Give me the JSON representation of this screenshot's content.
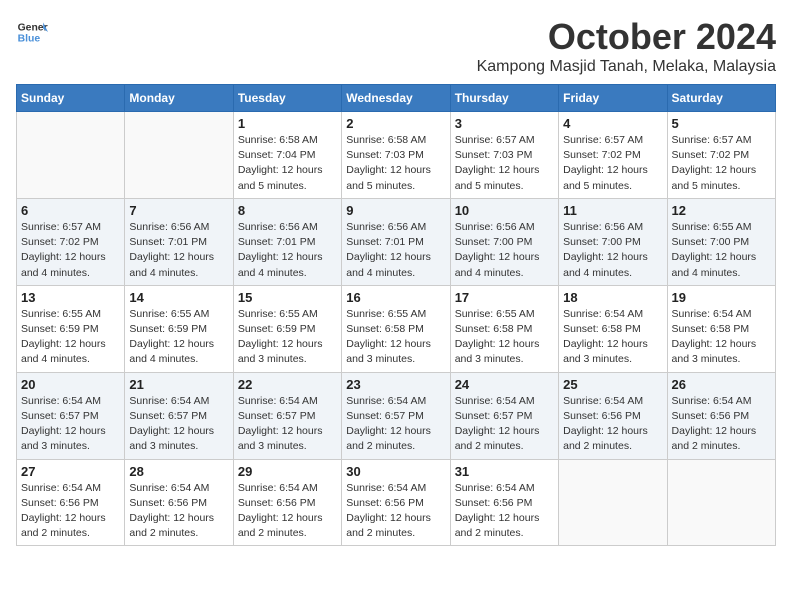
{
  "logo": {
    "line1": "General",
    "line2": "Blue"
  },
  "title": "October 2024",
  "location": "Kampong Masjid Tanah, Melaka, Malaysia",
  "headers": [
    "Sunday",
    "Monday",
    "Tuesday",
    "Wednesday",
    "Thursday",
    "Friday",
    "Saturday"
  ],
  "weeks": [
    [
      {
        "day": "",
        "info": ""
      },
      {
        "day": "",
        "info": ""
      },
      {
        "day": "1",
        "info": "Sunrise: 6:58 AM\nSunset: 7:04 PM\nDaylight: 12 hours\nand 5 minutes."
      },
      {
        "day": "2",
        "info": "Sunrise: 6:58 AM\nSunset: 7:03 PM\nDaylight: 12 hours\nand 5 minutes."
      },
      {
        "day": "3",
        "info": "Sunrise: 6:57 AM\nSunset: 7:03 PM\nDaylight: 12 hours\nand 5 minutes."
      },
      {
        "day": "4",
        "info": "Sunrise: 6:57 AM\nSunset: 7:02 PM\nDaylight: 12 hours\nand 5 minutes."
      },
      {
        "day": "5",
        "info": "Sunrise: 6:57 AM\nSunset: 7:02 PM\nDaylight: 12 hours\nand 5 minutes."
      }
    ],
    [
      {
        "day": "6",
        "info": "Sunrise: 6:57 AM\nSunset: 7:02 PM\nDaylight: 12 hours\nand 4 minutes."
      },
      {
        "day": "7",
        "info": "Sunrise: 6:56 AM\nSunset: 7:01 PM\nDaylight: 12 hours\nand 4 minutes."
      },
      {
        "day": "8",
        "info": "Sunrise: 6:56 AM\nSunset: 7:01 PM\nDaylight: 12 hours\nand 4 minutes."
      },
      {
        "day": "9",
        "info": "Sunrise: 6:56 AM\nSunset: 7:01 PM\nDaylight: 12 hours\nand 4 minutes."
      },
      {
        "day": "10",
        "info": "Sunrise: 6:56 AM\nSunset: 7:00 PM\nDaylight: 12 hours\nand 4 minutes."
      },
      {
        "day": "11",
        "info": "Sunrise: 6:56 AM\nSunset: 7:00 PM\nDaylight: 12 hours\nand 4 minutes."
      },
      {
        "day": "12",
        "info": "Sunrise: 6:55 AM\nSunset: 7:00 PM\nDaylight: 12 hours\nand 4 minutes."
      }
    ],
    [
      {
        "day": "13",
        "info": "Sunrise: 6:55 AM\nSunset: 6:59 PM\nDaylight: 12 hours\nand 4 minutes."
      },
      {
        "day": "14",
        "info": "Sunrise: 6:55 AM\nSunset: 6:59 PM\nDaylight: 12 hours\nand 4 minutes."
      },
      {
        "day": "15",
        "info": "Sunrise: 6:55 AM\nSunset: 6:59 PM\nDaylight: 12 hours\nand 3 minutes."
      },
      {
        "day": "16",
        "info": "Sunrise: 6:55 AM\nSunset: 6:58 PM\nDaylight: 12 hours\nand 3 minutes."
      },
      {
        "day": "17",
        "info": "Sunrise: 6:55 AM\nSunset: 6:58 PM\nDaylight: 12 hours\nand 3 minutes."
      },
      {
        "day": "18",
        "info": "Sunrise: 6:54 AM\nSunset: 6:58 PM\nDaylight: 12 hours\nand 3 minutes."
      },
      {
        "day": "19",
        "info": "Sunrise: 6:54 AM\nSunset: 6:58 PM\nDaylight: 12 hours\nand 3 minutes."
      }
    ],
    [
      {
        "day": "20",
        "info": "Sunrise: 6:54 AM\nSunset: 6:57 PM\nDaylight: 12 hours\nand 3 minutes."
      },
      {
        "day": "21",
        "info": "Sunrise: 6:54 AM\nSunset: 6:57 PM\nDaylight: 12 hours\nand 3 minutes."
      },
      {
        "day": "22",
        "info": "Sunrise: 6:54 AM\nSunset: 6:57 PM\nDaylight: 12 hours\nand 3 minutes."
      },
      {
        "day": "23",
        "info": "Sunrise: 6:54 AM\nSunset: 6:57 PM\nDaylight: 12 hours\nand 2 minutes."
      },
      {
        "day": "24",
        "info": "Sunrise: 6:54 AM\nSunset: 6:57 PM\nDaylight: 12 hours\nand 2 minutes."
      },
      {
        "day": "25",
        "info": "Sunrise: 6:54 AM\nSunset: 6:56 PM\nDaylight: 12 hours\nand 2 minutes."
      },
      {
        "day": "26",
        "info": "Sunrise: 6:54 AM\nSunset: 6:56 PM\nDaylight: 12 hours\nand 2 minutes."
      }
    ],
    [
      {
        "day": "27",
        "info": "Sunrise: 6:54 AM\nSunset: 6:56 PM\nDaylight: 12 hours\nand 2 minutes."
      },
      {
        "day": "28",
        "info": "Sunrise: 6:54 AM\nSunset: 6:56 PM\nDaylight: 12 hours\nand 2 minutes."
      },
      {
        "day": "29",
        "info": "Sunrise: 6:54 AM\nSunset: 6:56 PM\nDaylight: 12 hours\nand 2 minutes."
      },
      {
        "day": "30",
        "info": "Sunrise: 6:54 AM\nSunset: 6:56 PM\nDaylight: 12 hours\nand 2 minutes."
      },
      {
        "day": "31",
        "info": "Sunrise: 6:54 AM\nSunset: 6:56 PM\nDaylight: 12 hours\nand 2 minutes."
      },
      {
        "day": "",
        "info": ""
      },
      {
        "day": "",
        "info": ""
      }
    ]
  ]
}
